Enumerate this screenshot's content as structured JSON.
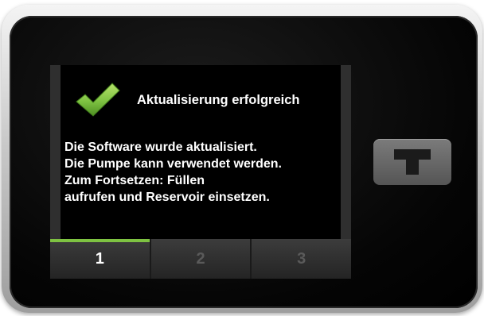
{
  "colors": {
    "accent": "#7ec242",
    "screen_background": "#000000",
    "tab_bar_background": "#2f2f2f",
    "active_tab_text": "#ffffff",
    "inactive_tab_text": "#5a5a5a"
  },
  "header": {
    "icon": "checkmark-icon",
    "title": "Aktualisierung erfolgreich"
  },
  "message": {
    "lines": [
      "Die Software wurde aktualisiert.",
      "Die Pumpe kann verwendet werden.",
      "Zum Fortsetzen: Füllen",
      "aufrufen und Reservoir einsetzen."
    ]
  },
  "tabs": [
    {
      "label": "1",
      "active": true
    },
    {
      "label": "2",
      "active": false
    },
    {
      "label": "3",
      "active": false
    }
  ],
  "device": {
    "hardware_button_icon": "t-logo-icon"
  }
}
